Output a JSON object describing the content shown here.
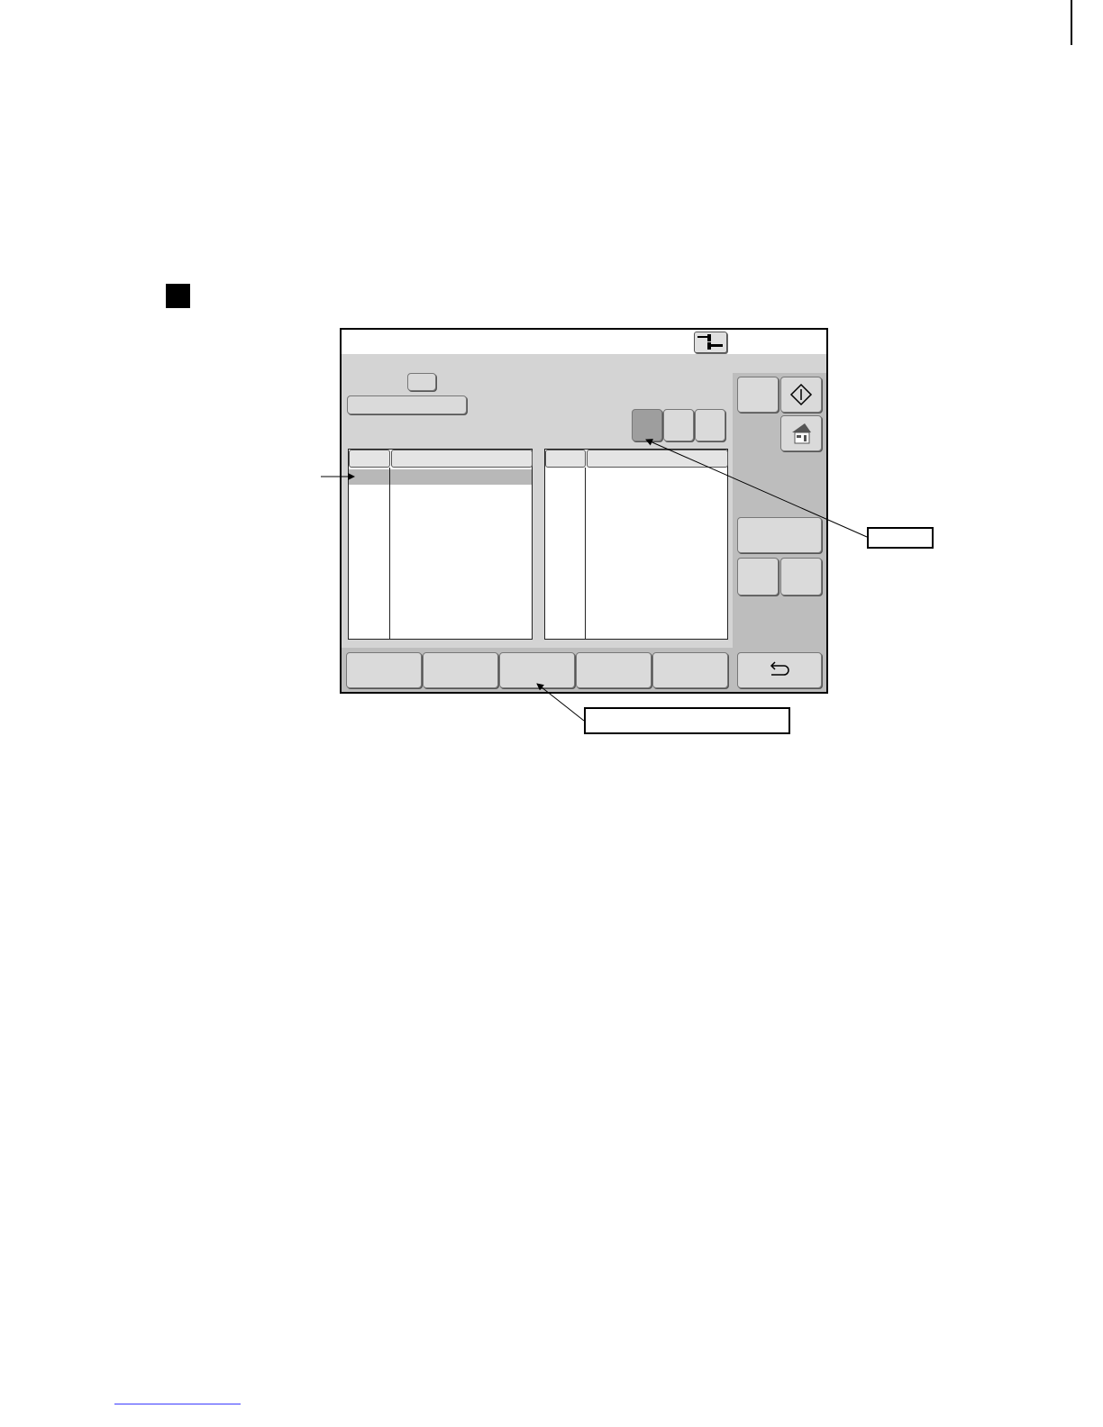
{
  "screen": {
    "title": "",
    "connection_icon": "connection-icon",
    "top_small_button_label": "",
    "top_wide_button_label": "",
    "mode_buttons": [
      "",
      "",
      ""
    ],
    "left_list": {
      "header_col1": "",
      "header_col2": "",
      "rows": []
    },
    "right_list": {
      "header_col1": "",
      "header_col2": "",
      "rows": []
    },
    "side_buttons": {
      "top_left_label": "",
      "start_icon": "start-diamond-icon",
      "home_icon": "home-icon",
      "wide_label": "",
      "small_left_label": "",
      "small_right_label": "",
      "back_icon": "return-arrow-icon"
    },
    "bottom_buttons": [
      "",
      "",
      "",
      "",
      ""
    ]
  },
  "callouts": {
    "right_box_text": "",
    "bottom_box_text": ""
  },
  "colors": {
    "screen_bg": "#d4d4d4",
    "panel_bg": "#bdbdbd",
    "selected_mode": "#9e9e9e",
    "highlight_row": "#b8b8b8"
  }
}
